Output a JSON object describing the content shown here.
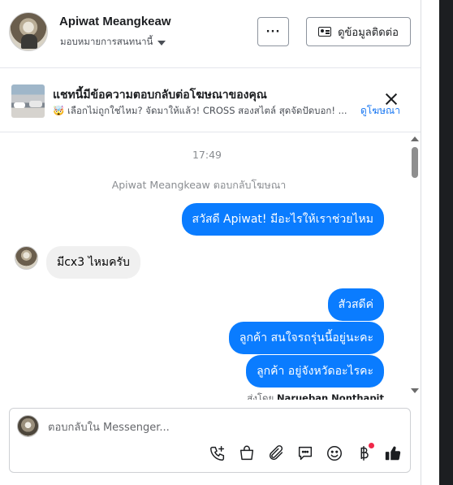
{
  "header": {
    "name": "Apiwat Meangkeaw",
    "assign_label": "มอบหมายการสนทนานี้",
    "more_label": "···",
    "contact_label": "ดูข้อมูลติดต่อ"
  },
  "ad": {
    "title": "แชทนี้มีข้อความตอบกลับต่อโฆษณาของคุณ",
    "subtitle": "🤯 เลือกไม่ถูกใช่ไหม? จัดมาให้แล้ว! CROSS สองสไตล์ สุดจัดปัดบอก! ...",
    "link_label": "ดูโฆษณา"
  },
  "chat": {
    "time": "17:49",
    "system_text": "Apiwat Meangkeaw ตอบกลับโฆษณา",
    "messages": [
      {
        "from": "page",
        "text": "สวัสดี Apiwat! มีอะไรให้เราช่วยไหม"
      },
      {
        "from": "user",
        "text": "มีcx3 ไหมครับ"
      },
      {
        "from": "page",
        "text": "สัวสดีค่"
      },
      {
        "from": "page",
        "text": "ลูกค้า  สนใจรถรุ่นนี้อยู่นะคะ"
      },
      {
        "from": "page",
        "text": "ลูกค้า   อยู่จังหวัดอะไรคะ"
      }
    ],
    "seen_prefix": "ส่งโดย",
    "seen_name": "Narueban Nonthapit"
  },
  "composer": {
    "placeholder": "ตอบกลับใน Messenger..."
  },
  "icons": {
    "tools": [
      "phone-plus-icon",
      "shopping-bag-icon",
      "paperclip-icon",
      "chat-bubble-icon",
      "smiley-icon",
      "baht-icon",
      "thumbs-up-icon"
    ]
  },
  "colors": {
    "accent": "#0a7cff",
    "link": "#1877f2",
    "notification": "#f02849"
  }
}
